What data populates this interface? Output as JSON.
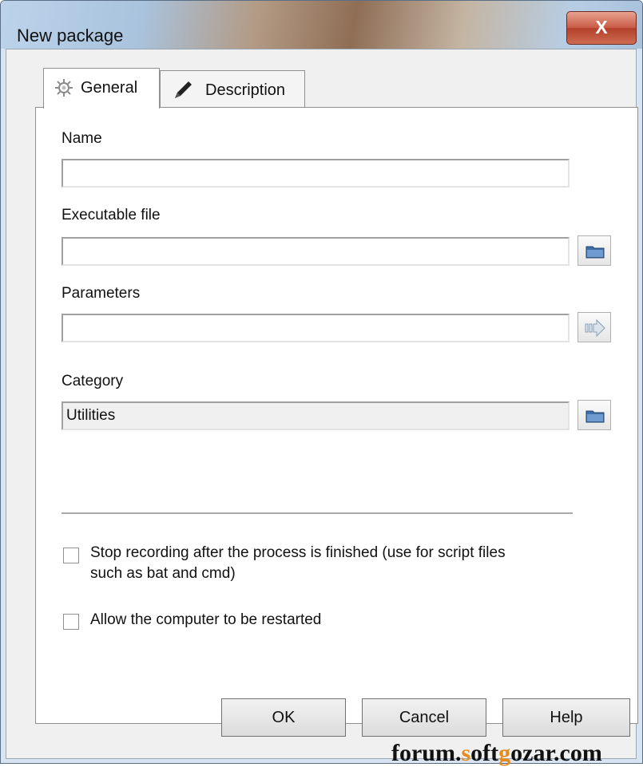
{
  "window": {
    "title": "New package",
    "close_label": "X"
  },
  "tabs": [
    {
      "label": "General",
      "icon": "gear-icon"
    },
    {
      "label": "Description",
      "icon": "pencil-icon"
    }
  ],
  "form": {
    "name": {
      "label": "Name",
      "value": ""
    },
    "executable": {
      "label": "Executable file",
      "value": "",
      "button_icon": "folder-icon"
    },
    "parameters": {
      "label": "Parameters",
      "value": "",
      "button_icon": "arrow-right-icon"
    },
    "category": {
      "label": "Category",
      "value": "Utilities",
      "button_icon": "folder-icon"
    }
  },
  "options": {
    "stop_recording": {
      "label": "Stop recording after the process is finished (use for script files such as bat and cmd)",
      "checked": false
    },
    "allow_restart": {
      "label": "Allow the computer to be restarted",
      "checked": false
    }
  },
  "buttons": {
    "ok": "OK",
    "cancel": "Cancel",
    "help": "Help"
  },
  "watermark": {
    "a": "forum.",
    "b": "s",
    "c": "oft",
    "d": "g",
    "e": "ozar.com"
  }
}
